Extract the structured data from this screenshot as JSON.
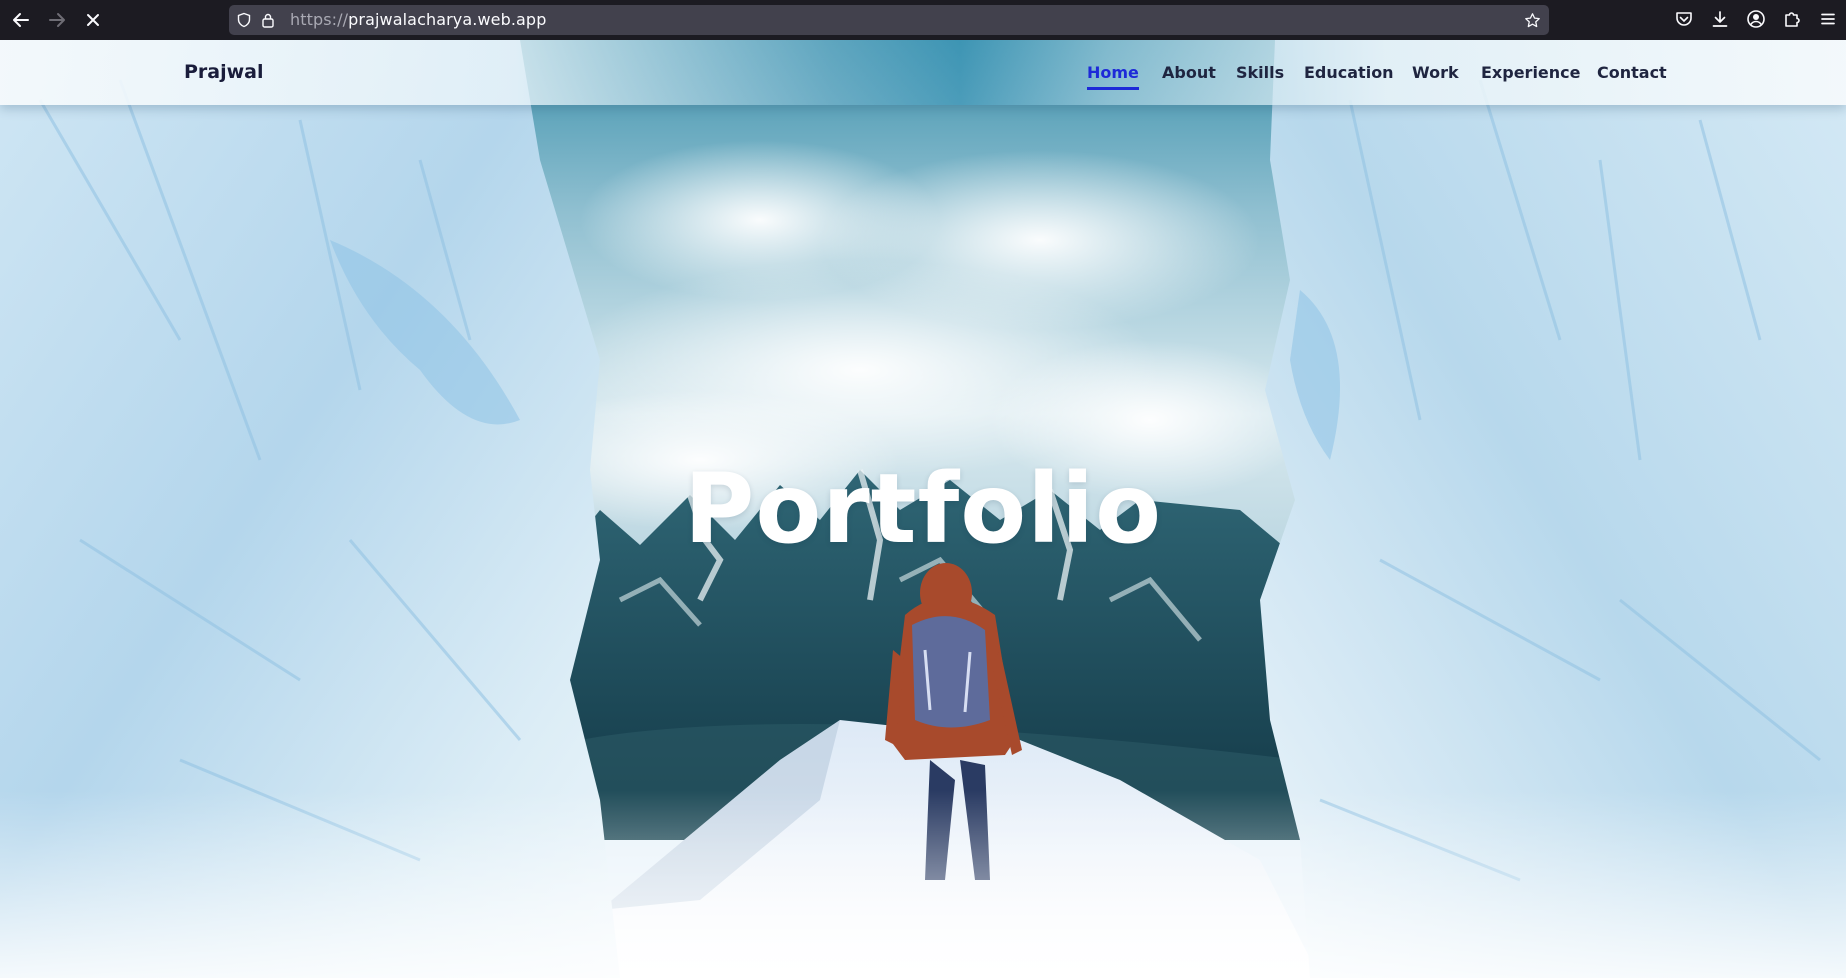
{
  "browser": {
    "url_protocol": "https://",
    "url_host": "prajwalacharya.web.app",
    "icons": {
      "back": "arrow-left-icon",
      "forward": "arrow-right-icon",
      "stop": "close-icon",
      "tracking": "shield-icon",
      "secure": "lock-icon",
      "bookmark": "star-icon",
      "pocket": "pocket-icon",
      "downloads": "download-icon",
      "account": "account-icon",
      "extensions": "puzzle-icon",
      "menu": "hamburger-menu-icon"
    }
  },
  "site": {
    "brand": "Prajwal",
    "nav": [
      {
        "label": "Home",
        "active": true
      },
      {
        "label": "About",
        "active": false
      },
      {
        "label": "Skills",
        "active": false
      },
      {
        "label": "Education",
        "active": false
      },
      {
        "label": "Work",
        "active": false
      },
      {
        "label": "Experience",
        "active": false
      },
      {
        "label": "Contact",
        "active": false
      }
    ],
    "hero_title": "Portfolio"
  },
  "colors": {
    "accent": "#1d29d8",
    "nav_text": "#1f2540",
    "chrome_bg": "#1c1b22",
    "urlbar_bg": "#42414d"
  }
}
